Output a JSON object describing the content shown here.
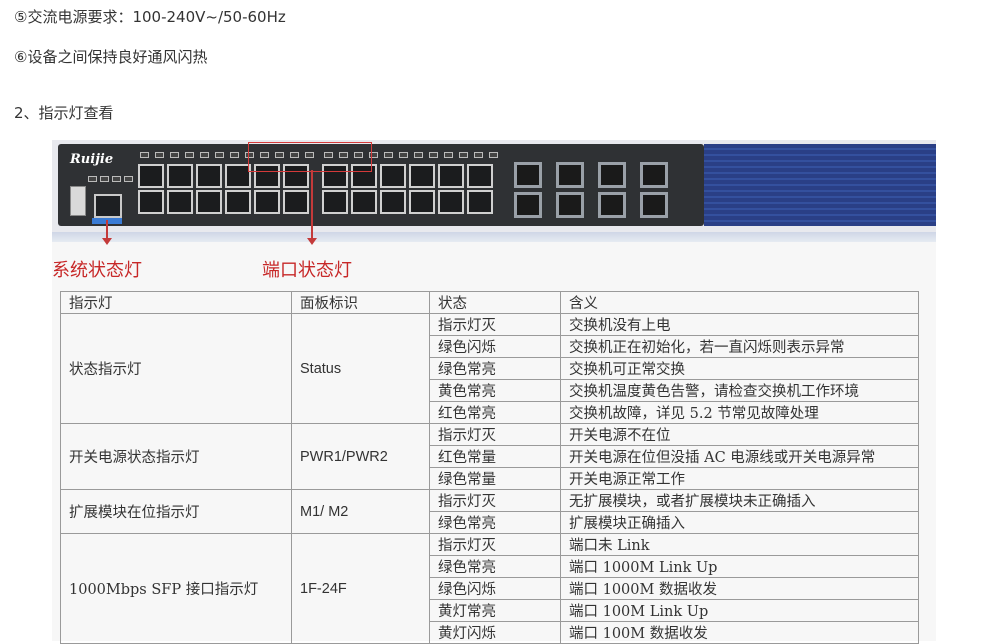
{
  "text": {
    "line1": "⑤交流电源要求：100-240V~/50-60Hz",
    "line2": "⑥设备之间保持良好通风闪热",
    "line3": "2、指示灯查看"
  },
  "figure": {
    "logo": "Ruijie",
    "callout_system": "系统状态灯",
    "callout_port": "端口状态灯"
  },
  "table": {
    "headers": [
      "指示灯",
      "面板标识",
      "状态",
      "含义"
    ],
    "groups": [
      {
        "indicator": "状态指示灯",
        "label": "Status",
        "rows": [
          [
            "指示灯灭",
            "交换机没有上电"
          ],
          [
            "绿色闪烁",
            "交换机正在初始化，若一直闪烁则表示异常"
          ],
          [
            "绿色常亮",
            "交换机可正常交换"
          ],
          [
            "黄色常亮",
            "交换机温度黄色告警，请检查交换机工作环境"
          ],
          [
            "红色常亮",
            "交换机故障，详见 5.2 节常见故障处理"
          ]
        ]
      },
      {
        "indicator": "开关电源状态指示灯",
        "label": "PWR1/PWR2",
        "rows": [
          [
            "指示灯灭",
            "开关电源不在位"
          ],
          [
            "红色常量",
            "开关电源在位但没插 AC 电源线或开关电源异常"
          ],
          [
            "绿色常量",
            "开关电源正常工作"
          ]
        ]
      },
      {
        "indicator": "扩展模块在位指示灯",
        "label": "M1/ M2",
        "rows": [
          [
            "指示灯灭",
            "无扩展模块，或者扩展模块未正确插入"
          ],
          [
            "绿色常亮",
            "扩展模块正确插入"
          ]
        ]
      },
      {
        "indicator": "1000Mbps SFP 接口指示灯",
        "label": "1F-24F",
        "rows": [
          [
            "指示灯灭",
            "端口未 Link"
          ],
          [
            "绿色常亮",
            "端口 1000M Link Up"
          ],
          [
            "绿色闪烁",
            "端口 1000M 数据收发"
          ],
          [
            "黄灯常亮",
            "端口 100M Link Up"
          ],
          [
            "黄灯闪烁",
            "端口 100M 数据收发"
          ]
        ]
      }
    ]
  },
  "colors": {
    "callout_red": "#c72828",
    "switch_panel": "#2a3f86"
  }
}
